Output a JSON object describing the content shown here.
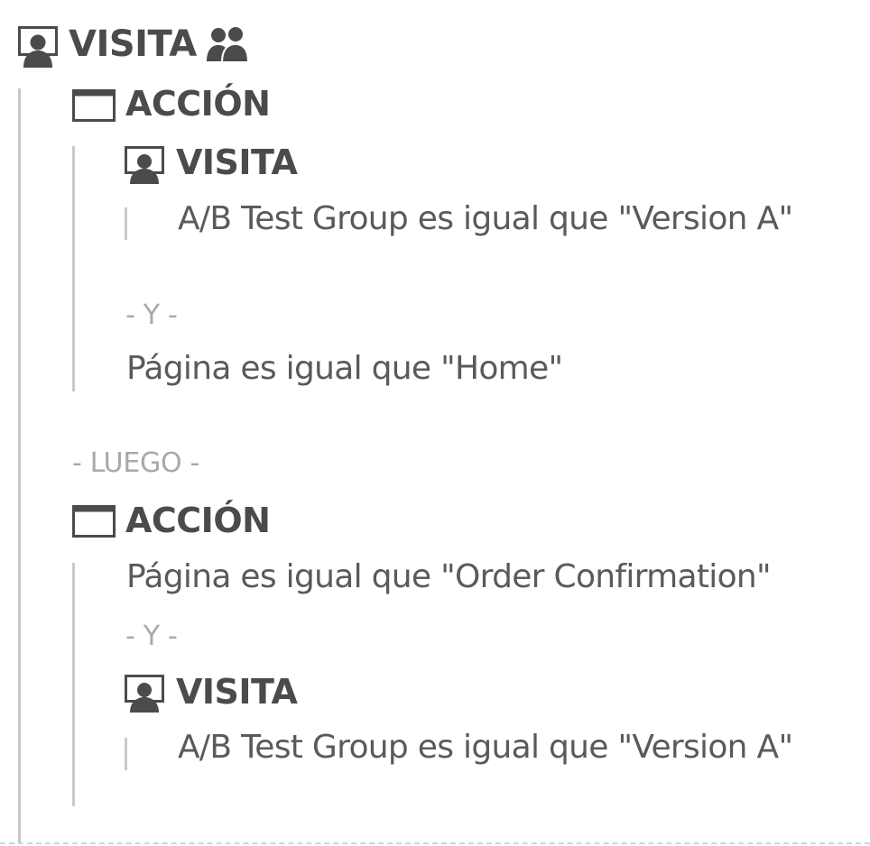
{
  "root": {
    "label": "VISITA",
    "icon": "visit-icon",
    "extra_icon": "people-icon",
    "container1": {
      "label": "ACCIÓN",
      "icon": "hit-container-icon",
      "inner_visit": {
        "label": "VISITA",
        "icon": "visit-icon",
        "condition": "A/B Test Group es igual que \"Version A\""
      },
      "op_y": "- Y -",
      "condition": "Página es igual que \"Home\""
    },
    "sequence_op": "- LUEGO -",
    "container2": {
      "label": "ACCIÓN",
      "icon": "hit-container-icon",
      "condition": "Página es igual que \"Order Confirmation\"",
      "op_y": "- Y -",
      "inner_visit": {
        "label": "VISITA",
        "icon": "visit-icon",
        "condition": "A/B Test Group es igual que \"Version A\""
      }
    }
  },
  "colors": {
    "text": "#4b4b4b",
    "operator": "#a8a8a8",
    "rule": "#c8c8c8"
  }
}
